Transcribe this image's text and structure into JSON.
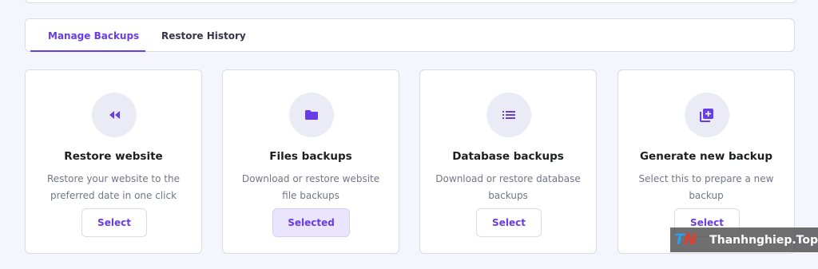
{
  "tabs": [
    {
      "label": "Manage Backups",
      "active": true
    },
    {
      "label": "Restore History",
      "active": false
    }
  ],
  "cards": [
    {
      "title": "Restore website",
      "description": "Restore your website to the preferred date in one click",
      "button": "Select",
      "icon": "rewind-icon"
    },
    {
      "title": "Files backups",
      "description": "Download or restore website file backups",
      "button": "Selected",
      "icon": "folder-icon"
    },
    {
      "title": "Database backups",
      "description": "Download or restore database backups",
      "button": "Select",
      "icon": "list-icon"
    },
    {
      "title": "Generate new backup",
      "description": "Select this to prepare a new backup",
      "button": "Select",
      "icon": "add-box-icon"
    }
  ],
  "watermark": {
    "text": "Thanhnghiep.Top"
  },
  "colors": {
    "accent": "#673de6",
    "background": "#f4f5fd",
    "selected_bg": "#ebe4ff"
  }
}
